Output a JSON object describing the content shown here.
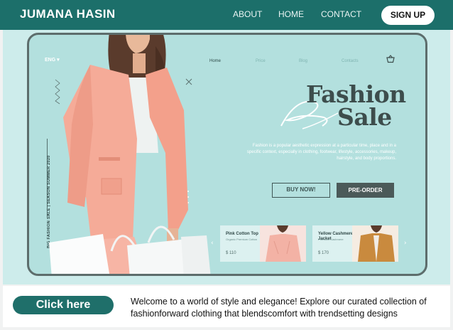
{
  "header": {
    "brand": "JUMANA HASIN",
    "nav": {
      "about": "ABOUT",
      "home": "HOME",
      "contact": "CONTACT"
    },
    "signup_label": "SIGN UP"
  },
  "mockup": {
    "lang": "ENG ▾",
    "nav": {
      "home": "Home",
      "price": "Price",
      "blog": "Blog",
      "contacts": "Contacts"
    },
    "cart_icon": "shopping-basket-icon",
    "side_text": "BIG FASHION SALE | SEASON SUMMER 2020",
    "headline": {
      "script": "Big",
      "line1": "Fashion",
      "line2": "Sale"
    },
    "description": "Fashion is a popular aesthetic expression at a particular time, place and in a specific context, especially in clothing, footwear, lifestyle, accessories, makeup, hairstyle, and body proportions.",
    "buttons": {
      "buy_now": "BUY NOW!",
      "pre_order": "PRE-ORDER"
    },
    "cards": [
      {
        "name": "Pink Cotton Top",
        "subtitle": "Organic Premium Cotton",
        "price": "$ 110"
      },
      {
        "name": "Yellow Cashmere Jacket",
        "subtitle": "Premium Cashmere",
        "price": "$ 170"
      }
    ],
    "arrows": {
      "left": "‹",
      "right": "›"
    }
  },
  "cta": {
    "button_label": "Click here",
    "text": "Welcome to a world of style and elegance! Explore our curated collection of fashionforward clothing that blendscomfort with trendsetting designs"
  },
  "colors": {
    "header_bg": "#1c6f6a",
    "hero_bg": "#cdeceb",
    "accent": "#1f6f6a",
    "coat": "#f5ab98"
  }
}
